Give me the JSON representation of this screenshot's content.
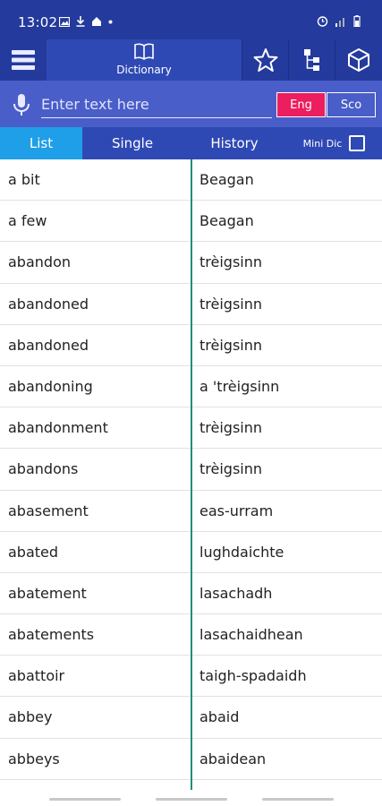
{
  "status": {
    "time": "13:02"
  },
  "toolbar": {
    "dictionary_label": "Dictionary"
  },
  "search": {
    "placeholder": "Enter text here",
    "value": ""
  },
  "lang": {
    "from": "Eng",
    "to": "Sco"
  },
  "tabs": {
    "list": "List",
    "single": "Single",
    "history": "History",
    "mini": "Mini Dic"
  },
  "rows": [
    {
      "en": "a bit",
      "gd": "Beagan"
    },
    {
      "en": "a few",
      "gd": "Beagan"
    },
    {
      "en": "abandon",
      "gd": "trèigsinn"
    },
    {
      "en": "abandoned",
      "gd": "trèigsinn"
    },
    {
      "en": "abandoned",
      "gd": "trèigsinn"
    },
    {
      "en": "abandoning",
      "gd": "a 'trèigsinn"
    },
    {
      "en": "abandonment",
      "gd": "trèigsinn"
    },
    {
      "en": "abandons",
      "gd": "trèigsinn"
    },
    {
      "en": "abasement",
      "gd": "eas-urram"
    },
    {
      "en": "abated",
      "gd": "lughdaichte"
    },
    {
      "en": "abatement",
      "gd": "lasachadh"
    },
    {
      "en": "abatements",
      "gd": "lasachaidhean"
    },
    {
      "en": "abattoir",
      "gd": "taigh-spadaidh"
    },
    {
      "en": "abbey",
      "gd": "abaid"
    },
    {
      "en": "abbeys",
      "gd": "abaidean"
    }
  ],
  "colors": {
    "primary": "#243a9c",
    "search_bg": "#4a5ec9",
    "active_tab": "#1e9fe7",
    "accent": "#ec1e5f",
    "divider": "#1d8f7d"
  }
}
